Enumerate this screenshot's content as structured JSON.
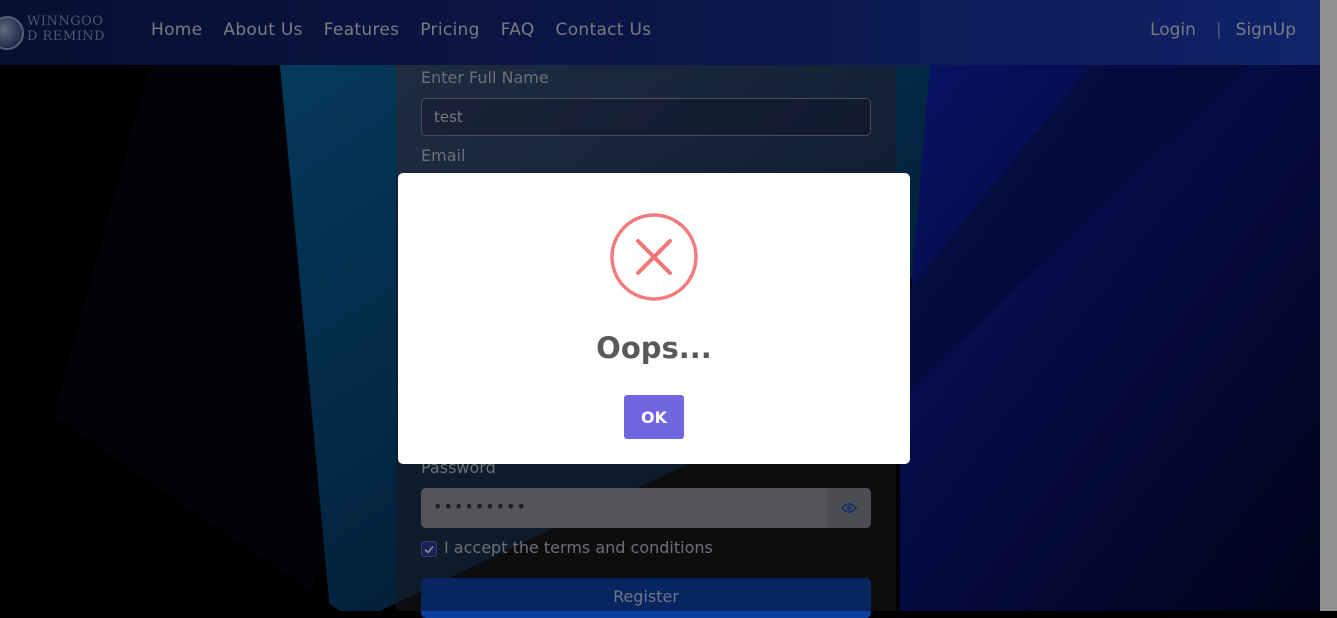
{
  "brand": {
    "line1": "WINNGOO",
    "line2": "D REMIND"
  },
  "nav": {
    "links": [
      "Home",
      "About Us",
      "Features",
      "Pricing",
      "FAQ",
      "Contact Us"
    ],
    "login": "Login",
    "separator": "|",
    "signup": "SignUp"
  },
  "form": {
    "full_name_label": "Enter Full Name",
    "full_name_value": "test",
    "email_label": "Email",
    "password_label": "Password",
    "password_value": "•••••••••",
    "terms_label": "I accept the terms and conditions",
    "terms_checked": true,
    "register_label": "Register"
  },
  "modal": {
    "icon": "error-x-icon",
    "title": "Oops...",
    "ok_label": "OK"
  },
  "colors": {
    "accent": "#7066e0",
    "error": "#f27474",
    "register": "#0d3f9e"
  }
}
